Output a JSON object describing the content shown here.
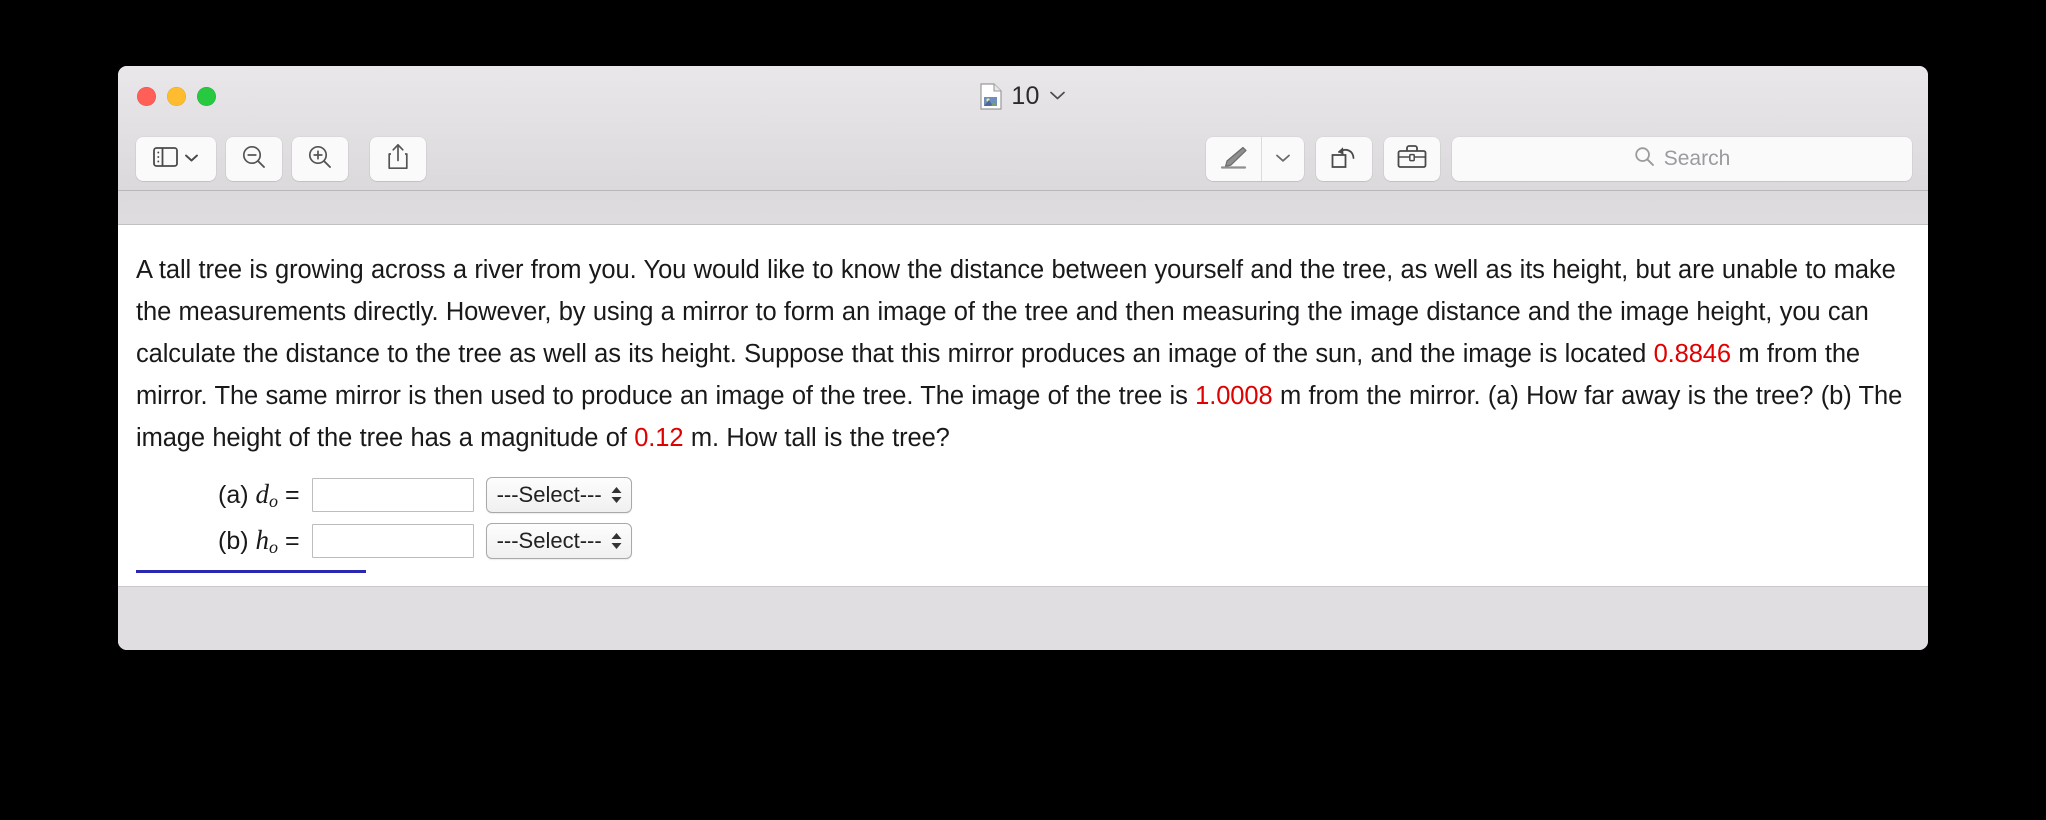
{
  "window": {
    "title": "10",
    "doc_icon": "preview-document-icon",
    "title_chevron": "chevron-down-icon",
    "traffic_lights": {
      "close": "close-window-button",
      "minimize": "minimize-window-button",
      "maximize": "maximize-window-button"
    },
    "colors": {
      "close": "#ff5f57",
      "minimize": "#febc2e",
      "maximize": "#28c840",
      "accent_value": "#e00000",
      "rule": "#2a27b0"
    }
  },
  "toolbar": {
    "sidebar_button": "sidebar-icon",
    "sidebar_chevron": "chevron-down-icon",
    "zoom_out_button": "zoom-out-icon",
    "zoom_in_button": "zoom-in-icon",
    "share_button": "share-icon",
    "highlight_button": "highlighter-pen-icon",
    "highlight_chevron": "chevron-down-icon",
    "rotate_button": "rotate-left-icon",
    "markup_button": "markup-toolbox-icon",
    "search": {
      "icon": "search-icon",
      "placeholder": "Search",
      "value": ""
    }
  },
  "document": {
    "paragraph": {
      "part1": "A tall tree is growing across a river from you. You would like to know the distance between yourself and the tree, as well as its height, but are unable to make the measurements directly. However, by using a mirror to form an image of the tree and then measuring the image distance and the image height, you can calculate the distance to the tree as well as its height. Suppose that this mirror produces an image of the sun, and the image is located ",
      "value1": "0.8846",
      "part2": " m from the mirror. The same mirror is then used to produce an image of the tree. The image of the tree is ",
      "value2": "1.0008",
      "part3": " m from the mirror. (a) How far away is the tree? (b) The image height of the tree has a magnitude of ",
      "value3": "0.12",
      "part4": " m. How tall is the tree?"
    },
    "answers": [
      {
        "prefix": "(a)",
        "symbol": "d",
        "subscript": "o",
        "equals": "=",
        "input_value": "",
        "select_value": "---Select---"
      },
      {
        "prefix": "(b)",
        "symbol": "h",
        "subscript": "o",
        "equals": "=",
        "input_value": "",
        "select_value": "---Select---"
      }
    ]
  }
}
